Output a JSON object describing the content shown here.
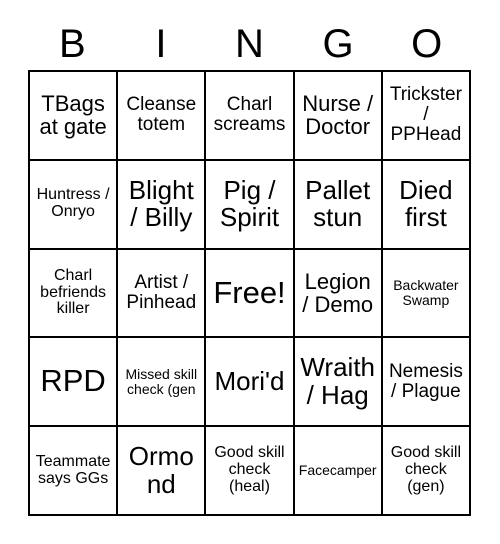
{
  "card": {
    "header_letters": [
      "B",
      "I",
      "N",
      "G",
      "O"
    ],
    "size": "5x5",
    "colors": {
      "background": "#ffffff",
      "border": "#000000",
      "text": "#000000"
    },
    "rows": [
      [
        {
          "label": "TBags at gate",
          "size": "lg"
        },
        {
          "label": "Cleanse totem",
          "size": "md"
        },
        {
          "label": "Charl screams",
          "size": "md"
        },
        {
          "label": "Nurse / Doctor",
          "size": "lg"
        },
        {
          "label": "Trickster / PPHead",
          "size": "md"
        }
      ],
      [
        {
          "label": "Huntress / Onryo",
          "size": "sm"
        },
        {
          "label": "Blight / Billy",
          "size": "xl"
        },
        {
          "label": "Pig / Spirit",
          "size": "xl"
        },
        {
          "label": "Pallet stun",
          "size": "xl"
        },
        {
          "label": "Died first",
          "size": "xl"
        }
      ],
      [
        {
          "label": "Charl befriends killer",
          "size": "sm"
        },
        {
          "label": "Artist / Pinhead",
          "size": "md"
        },
        {
          "label": "Free!",
          "size": "xxl"
        },
        {
          "label": "Legion / Demo",
          "size": "lg"
        },
        {
          "label": "Backwater Swamp",
          "size": "xs"
        }
      ],
      [
        {
          "label": "RPD",
          "size": "xxl"
        },
        {
          "label": "Missed skill check (gen",
          "size": "xs"
        },
        {
          "label": "Mori'd",
          "size": "xl"
        },
        {
          "label": "Wraith / Hag",
          "size": "xl"
        },
        {
          "label": "Nemesis / Plague",
          "size": "md"
        }
      ],
      [
        {
          "label": "Teammate says GGs",
          "size": "sm"
        },
        {
          "label": "Ormond",
          "size": "xl"
        },
        {
          "label": "Good skill check (heal)",
          "size": "sm"
        },
        {
          "label": "Facecamper",
          "size": "xs"
        },
        {
          "label": "Good skill check (gen)",
          "size": "sm"
        }
      ]
    ]
  }
}
